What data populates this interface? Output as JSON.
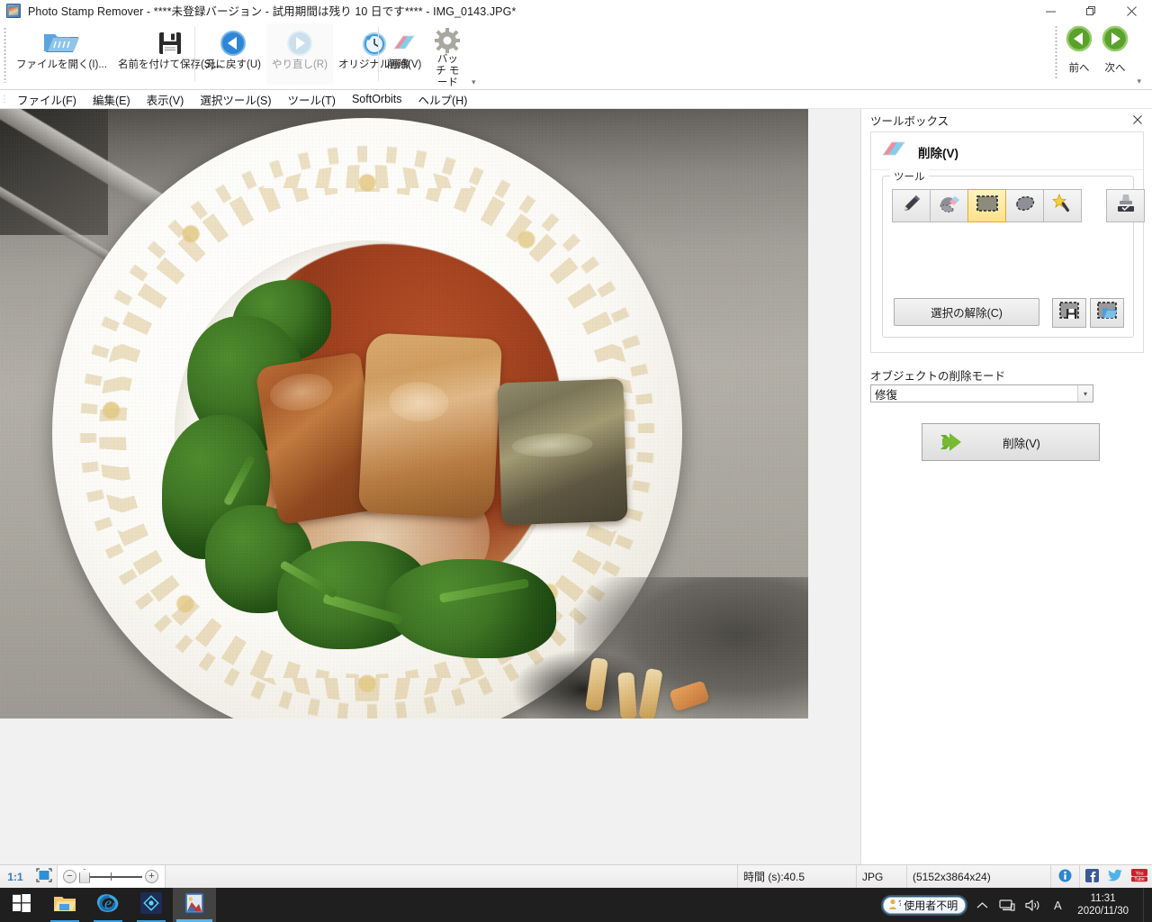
{
  "window": {
    "title": "Photo Stamp Remover - ****未登録バージョン - 試用期間は残り 10 日です**** - IMG_0143.JPG*",
    "icon": "app-icon",
    "minimize": "−",
    "maximize": "❐",
    "close": "✕"
  },
  "ribbon": {
    "items": [
      {
        "label": "ファイルを開く(I)...",
        "icon": "open-folder-icon",
        "enabled": true
      },
      {
        "label": "名前を付けて保存(S)...",
        "icon": "floppy-save-icon",
        "enabled": true
      },
      {
        "label": "元に戻す(U)",
        "icon": "undo-arrow-icon",
        "enabled": true
      },
      {
        "label": "やり直し(R)",
        "icon": "redo-arrow-icon",
        "enabled": false
      },
      {
        "label": "オリジナル画像",
        "icon": "clock-history-icon",
        "enabled": true
      },
      {
        "label": "削除(V)",
        "icon": "eraser-icon",
        "enabled": true
      },
      {
        "label": "バッチ モード",
        "icon": "gear-icon",
        "enabled": true
      }
    ],
    "collapse_glyph": "▾"
  },
  "navigation": {
    "prev": {
      "label": "前へ",
      "icon": "prev-circle-icon"
    },
    "next": {
      "label": "次へ",
      "icon": "next-circle-icon"
    },
    "collapse_glyph": "▾"
  },
  "menubar": {
    "grip": "⋮",
    "items": [
      "ファイル(F)",
      "編集(E)",
      "表示(V)",
      "選択ツール(S)",
      "ツール(T)",
      "SoftOrbits",
      "ヘルプ(H)"
    ]
  },
  "toolbox": {
    "panel_title": "ツールボックス",
    "close": "✕",
    "card_title": "削除(V)",
    "card_icon": "eraser-icon",
    "tools_legend": "ツール",
    "tools": [
      {
        "name": "pencil-tool",
        "selected": false
      },
      {
        "name": "eraser-brush-tool",
        "selected": false
      },
      {
        "name": "rectangle-select-tool",
        "selected": true
      },
      {
        "name": "lasso-select-tool",
        "selected": false
      },
      {
        "name": "magic-wand-tool",
        "selected": false
      },
      {
        "name": "clone-stamp-tool",
        "selected": false
      }
    ],
    "deselect_label": "選択の解除(C)",
    "save_selection_icon": "save-selection-icon",
    "load_selection_icon": "load-selection-icon",
    "mode_label": "オブジェクトの削除モード",
    "mode_value": "修復",
    "mode_arrow": "▾",
    "remove_label": "削除(V)",
    "remove_icon": "green-arrow-icon"
  },
  "statusbar": {
    "zoom_ratio": "1:1",
    "fit_icon": "fit-to-window-icon",
    "zoom_out": "−",
    "zoom_in": "+",
    "time": "時間 (s):40.5",
    "format": "JPG",
    "dimensions": "(5152x3864x24)",
    "info_icon": "info-icon",
    "facebook_icon": "facebook-icon",
    "twitter_icon": "twitter-icon",
    "youtube_icon": "youtube-icon"
  },
  "taskbar": {
    "start": "start-icon",
    "apps": [
      {
        "name": "file-explorer-icon"
      },
      {
        "name": "internet-explorer-icon"
      },
      {
        "name": "blue-diamond-app-icon"
      },
      {
        "name": "photo-stamp-remover-icon"
      }
    ],
    "ime_label": "使用者不明",
    "ime_icon": "ime-user-icon",
    "chevron_up": "⌃",
    "network_icon": "network-icon",
    "volume_icon": "volume-icon",
    "language_icon": "A",
    "time": "11:31",
    "date": "2020/11/30"
  },
  "colors": {
    "accent_blue": "#1e8bd6",
    "green": "#6fad2f",
    "highlight_yellow": "#ffe288",
    "taskbar": "#1f1f1f"
  }
}
